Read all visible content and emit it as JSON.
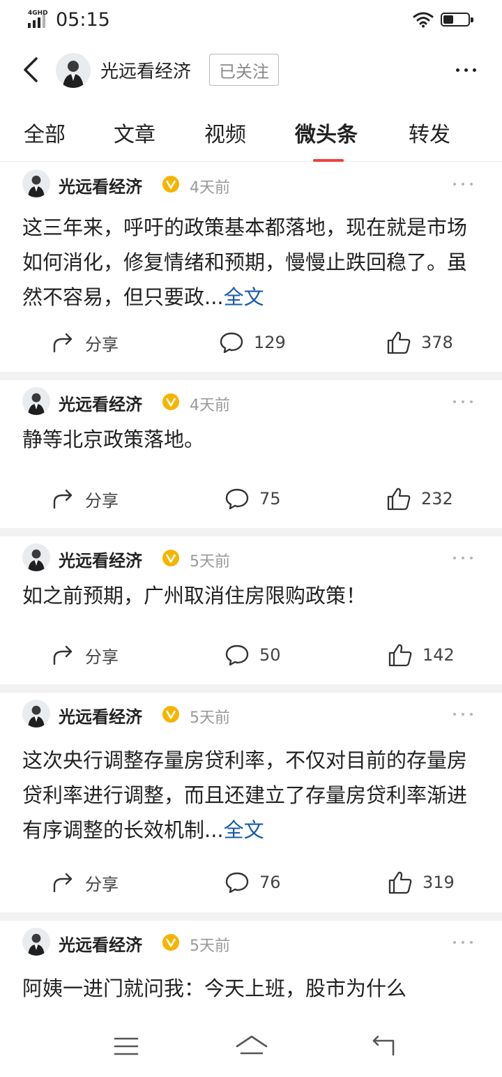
{
  "status": {
    "network": "4GHD",
    "time": "05:15"
  },
  "header": {
    "name": "光远看经济",
    "follow_label": "已关注"
  },
  "tabs": [
    {
      "label": "全部",
      "active": false
    },
    {
      "label": "文章",
      "active": false
    },
    {
      "label": "视频",
      "active": false
    },
    {
      "label": "微头条",
      "active": true
    },
    {
      "label": "转发",
      "active": false
    }
  ],
  "share_label": "分享",
  "full_text_label": "全文",
  "posts": [
    {
      "author": "光远看经济",
      "time": "4天前",
      "text": "这三年来，呼吁的政策基本都落地，现在就是市场如何消化，修复情绪和预期，慢慢止跌回稳了。虽然不容易，但只要政...",
      "truncated": true,
      "comments": "129",
      "likes": "378"
    },
    {
      "author": "光远看经济",
      "time": "4天前",
      "text": "静等北京政策落地。",
      "truncated": false,
      "comments": "75",
      "likes": "232"
    },
    {
      "author": "光远看经济",
      "time": "5天前",
      "text": "如之前预期，广州取消住房限购政策！",
      "truncated": false,
      "comments": "50",
      "likes": "142"
    },
    {
      "author": "光远看经济",
      "time": "5天前",
      "text": "这次央行调整存量房贷利率，不仅对目前的存量房贷利率进行调整，而且还建立了存量房贷利率渐进有序调整的长效机制...",
      "truncated": true,
      "comments": "76",
      "likes": "319"
    },
    {
      "author": "光远看经济",
      "time": "5天前",
      "text": "阿姨一进门就问我：今天上班，股市为什么",
      "truncated": false,
      "comments": "",
      "likes": ""
    }
  ],
  "colors": {
    "accent": "#f04142",
    "link": "#1a5aa8",
    "verified": "#f5b400",
    "muted": "#999999"
  }
}
